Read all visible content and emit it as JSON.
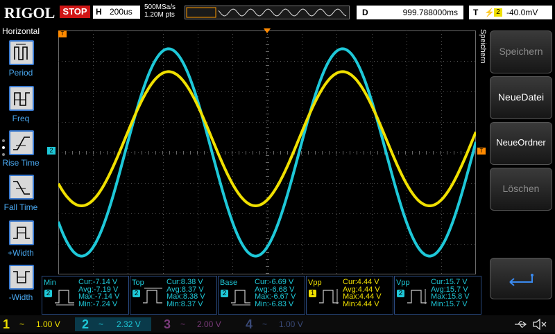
{
  "header": {
    "logo": "RIGOL",
    "run_state": "STOP",
    "timebase_label": "H",
    "timebase_value": "200us",
    "sample_rate": "500MSa/s",
    "memory_depth": "1.20M pts",
    "delay_label": "D",
    "delay_value": "999.788000ms",
    "trigger_label": "T",
    "trigger_source": "2",
    "trigger_level": "-40.0mV"
  },
  "left_menu": {
    "title": "Horizontal",
    "items": [
      {
        "label": "Period",
        "icon": "period-icon"
      },
      {
        "label": "Freq",
        "icon": "frequency-icon"
      },
      {
        "label": "Rise Time",
        "icon": "rise-time-icon"
      },
      {
        "label": "Fall Time",
        "icon": "fall-time-icon"
      },
      {
        "label": "+Width",
        "icon": "positive-width-icon"
      },
      {
        "label": "-Width",
        "icon": "negative-width-icon"
      }
    ]
  },
  "right_menu": {
    "title": "Speichern",
    "buttons": [
      {
        "label": "Speichern",
        "enabled": false
      },
      {
        "label": "NeueDatei",
        "enabled": true
      },
      {
        "label": "NeueOrdner",
        "enabled": true
      },
      {
        "label": "Löschen",
        "enabled": false
      }
    ],
    "back_icon": "return-arrow-icon"
  },
  "markers": {
    "trigger_pos": "T",
    "ch2_ref": "2",
    "trigger_level_marker": "T"
  },
  "measurements": [
    {
      "name": "Min",
      "source": "2",
      "color": "#1ec8d8",
      "cur": "Cur:-7.14 V",
      "avg": "Avg:-7.19 V",
      "max": "Max:-7.14 V",
      "min": "Min:-7.24 V"
    },
    {
      "name": "Top",
      "source": "2",
      "color": "#1ec8d8",
      "cur": "Cur:8.38 V",
      "avg": "Avg:8.37 V",
      "max": "Max:8.38 V",
      "min": "Min:8.37 V"
    },
    {
      "name": "Base",
      "source": "2",
      "color": "#1ec8d8",
      "cur": "Cur:-6.69 V",
      "avg": "Avg:-6.68 V",
      "max": "Max:-6.67 V",
      "min": "Min:-6.83 V"
    },
    {
      "name": "Vpp",
      "source": "1",
      "color": "#f0e000",
      "cur": "Cur:4.44 V",
      "avg": "Avg:4.44 V",
      "max": "Max:4.44 V",
      "min": "Min:4.44 V"
    },
    {
      "name": "Vpp",
      "source": "2",
      "color": "#1ec8d8",
      "cur": "Cur:15.7 V",
      "avg": "Avg:15.7 V",
      "max": "Max:15.8 V",
      "min": "Min:15.7 V"
    }
  ],
  "channels": [
    {
      "num": "1",
      "coupling": "~",
      "scale": "1.00 V",
      "color": "#f0e000",
      "active": true
    },
    {
      "num": "2",
      "coupling": "~",
      "scale": "2.32 V",
      "color": "#1ec8d8",
      "active": true
    },
    {
      "num": "3",
      "coupling": "~",
      "scale": "2.00 V",
      "color": "#c040c0",
      "active": false
    },
    {
      "num": "4",
      "coupling": "~",
      "scale": "1.00 V",
      "color": "#4a70c8",
      "active": false
    }
  ],
  "status_icons": [
    "usb-icon",
    "speaker-muted-icon"
  ],
  "waveforms": {
    "ch1": {
      "color": "#f0e000",
      "amplitude_div": 2.2,
      "offset_div": 0.45
    },
    "ch2": {
      "color": "#1ec8d8",
      "amplitude_div": 3.4,
      "offset_div": 0.0
    },
    "periods_shown": 2.4,
    "phase_deg": 0
  }
}
